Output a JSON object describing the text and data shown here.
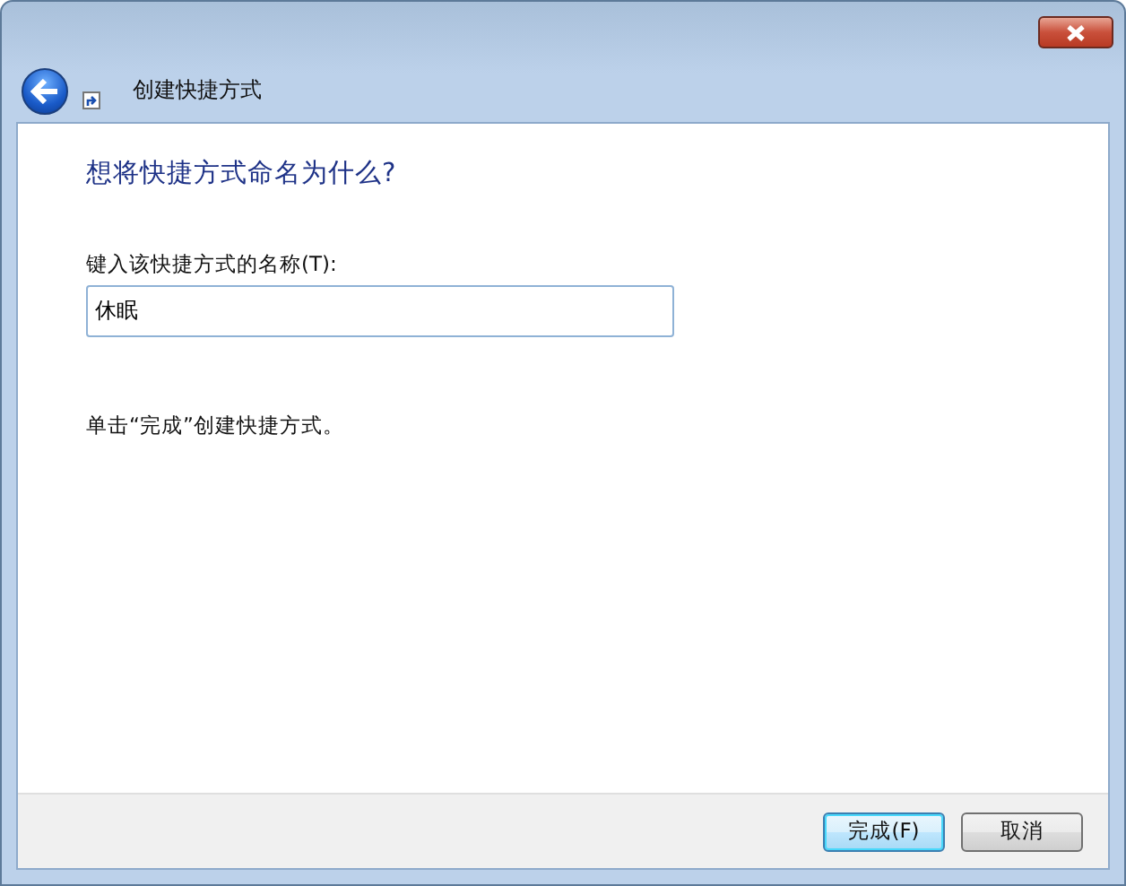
{
  "window": {
    "title": "创建快捷方式"
  },
  "heading": "想将快捷方式命名为什么?",
  "name_field": {
    "label": "键入该快捷方式的名称(T):",
    "value": "休眠"
  },
  "hint": "单击“完成”创建快捷方式。",
  "buttons": [
    {
      "label": "完成(F)",
      "default": true
    },
    {
      "label": "取消",
      "default": false
    }
  ]
}
